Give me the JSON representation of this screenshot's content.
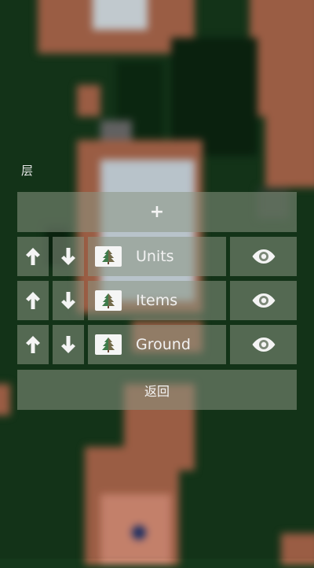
{
  "dialog": {
    "title": "层",
    "add_label": "+",
    "back_label": "返回"
  },
  "layers": [
    {
      "name": "Units",
      "icon": "tree-icon"
    },
    {
      "name": "Items",
      "icon": "tree-icon"
    },
    {
      "name": "Ground",
      "icon": "tree-icon"
    }
  ],
  "icons": {
    "move_up": "arrow-up-icon",
    "move_down": "arrow-down-icon",
    "visibility": "eye-icon",
    "layer": "tree-icon"
  },
  "colors": {
    "grass": "#15381b",
    "dirt": "#a8654a",
    "snow": "#c8d4dc",
    "button": "#8a9684",
    "text": "#f4f4f4"
  }
}
